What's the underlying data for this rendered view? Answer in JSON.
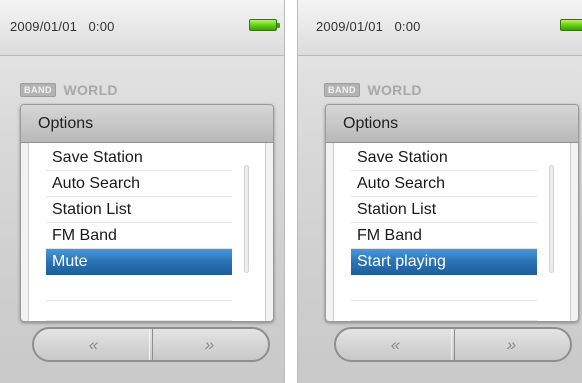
{
  "screens": [
    {
      "status": {
        "datetime": "2009/01/01   0:00"
      },
      "band": {
        "badge": "BAND",
        "name": "WORLD"
      },
      "dialog": {
        "title": "Options",
        "items": [
          "Save Station",
          "Auto Search",
          "Station List",
          "FM Band",
          "Mute"
        ],
        "selected_index": 4
      },
      "nav": {
        "prev_label": "«",
        "next_label": "»"
      }
    },
    {
      "status": {
        "datetime": "2009/01/01   0:00"
      },
      "band": {
        "badge": "BAND",
        "name": "WORLD"
      },
      "dialog": {
        "title": "Options",
        "items": [
          "Save Station",
          "Auto Search",
          "Station List",
          "FM Band",
          "Start playing"
        ],
        "selected_index": 4
      },
      "nav": {
        "prev_label": "«",
        "next_label": "»"
      }
    }
  ],
  "colors": {
    "selection": "#2a74b6",
    "battery": "#5fcc12"
  },
  "icons": {
    "battery": "battery-full-icon"
  }
}
